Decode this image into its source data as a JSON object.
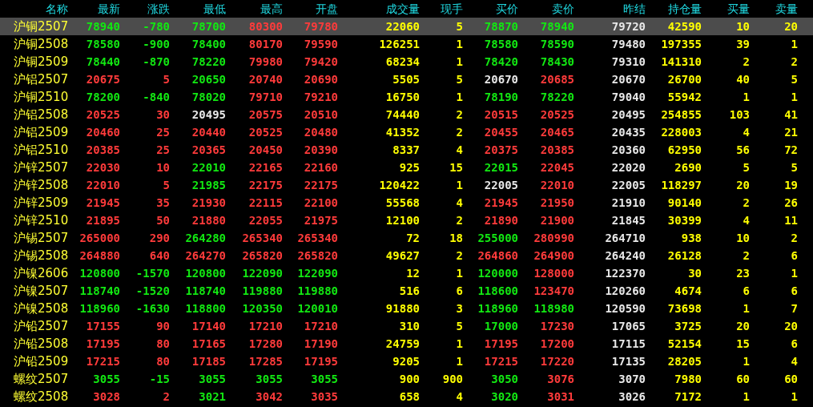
{
  "columns": [
    {
      "label": "名称",
      "kind": "name"
    },
    {
      "label": "最新",
      "kind": "price"
    },
    {
      "label": "涨跌",
      "kind": "price"
    },
    {
      "label": "最低",
      "kind": "price"
    },
    {
      "label": "最高",
      "kind": "price"
    },
    {
      "label": "开盘",
      "kind": "price"
    },
    {
      "label": "成交量",
      "kind": "qty"
    },
    {
      "label": "现手",
      "kind": "qty"
    },
    {
      "label": "买价",
      "kind": "price"
    },
    {
      "label": "卖价",
      "kind": "price"
    },
    {
      "label": "昨结",
      "kind": "settle"
    },
    {
      "label": "持仓量",
      "kind": "qty"
    },
    {
      "label": "买量",
      "kind": "qty"
    },
    {
      "label": "卖量",
      "kind": "qty"
    }
  ],
  "rows": [
    {
      "selected": true,
      "cells": [
        {
          "text": "沪铜2507"
        },
        {
          "text": "78940",
          "color": "#12e812"
        },
        {
          "text": "-780",
          "color": "#12e812"
        },
        {
          "text": "78700",
          "color": "#12e812"
        },
        {
          "text": "80300",
          "color": "#ff3b3b"
        },
        {
          "text": "79780",
          "color": "#ff3b3b"
        },
        {
          "text": "22060"
        },
        {
          "text": "5"
        },
        {
          "text": "78870",
          "color": "#12e812"
        },
        {
          "text": "78940",
          "color": "#12e812"
        },
        {
          "text": "79720"
        },
        {
          "text": "42590"
        },
        {
          "text": "10"
        },
        {
          "text": "20"
        }
      ]
    },
    {
      "selected": false,
      "cells": [
        {
          "text": "沪铜2508"
        },
        {
          "text": "78580",
          "color": "#12e812"
        },
        {
          "text": "-900",
          "color": "#12e812"
        },
        {
          "text": "78400",
          "color": "#12e812"
        },
        {
          "text": "80170",
          "color": "#ff3b3b"
        },
        {
          "text": "79590",
          "color": "#ff3b3b"
        },
        {
          "text": "126251"
        },
        {
          "text": "1"
        },
        {
          "text": "78580",
          "color": "#12e812"
        },
        {
          "text": "78590",
          "color": "#12e812"
        },
        {
          "text": "79480"
        },
        {
          "text": "197355"
        },
        {
          "text": "39"
        },
        {
          "text": "1"
        }
      ]
    },
    {
      "selected": false,
      "cells": [
        {
          "text": "沪铜2509"
        },
        {
          "text": "78440",
          "color": "#12e812"
        },
        {
          "text": "-870",
          "color": "#12e812"
        },
        {
          "text": "78220",
          "color": "#12e812"
        },
        {
          "text": "79980",
          "color": "#ff3b3b"
        },
        {
          "text": "79420",
          "color": "#ff3b3b"
        },
        {
          "text": "68234"
        },
        {
          "text": "1"
        },
        {
          "text": "78420",
          "color": "#12e812"
        },
        {
          "text": "78430",
          "color": "#12e812"
        },
        {
          "text": "79310"
        },
        {
          "text": "141310"
        },
        {
          "text": "2"
        },
        {
          "text": "2"
        }
      ]
    },
    {
      "selected": false,
      "cells": [
        {
          "text": "沪铝2507"
        },
        {
          "text": "20675",
          "color": "#ff3b3b"
        },
        {
          "text": "5",
          "color": "#ff3b3b"
        },
        {
          "text": "20650",
          "color": "#12e812"
        },
        {
          "text": "20740",
          "color": "#ff3b3b"
        },
        {
          "text": "20690",
          "color": "#ff3b3b"
        },
        {
          "text": "5505"
        },
        {
          "text": "5"
        },
        {
          "text": "20670",
          "color": "#e8e8e8"
        },
        {
          "text": "20685",
          "color": "#ff3b3b"
        },
        {
          "text": "20670"
        },
        {
          "text": "26700"
        },
        {
          "text": "40"
        },
        {
          "text": "5"
        }
      ]
    },
    {
      "selected": false,
      "cells": [
        {
          "text": "沪铜2510"
        },
        {
          "text": "78200",
          "color": "#12e812"
        },
        {
          "text": "-840",
          "color": "#12e812"
        },
        {
          "text": "78020",
          "color": "#12e812"
        },
        {
          "text": "79710",
          "color": "#ff3b3b"
        },
        {
          "text": "79210",
          "color": "#ff3b3b"
        },
        {
          "text": "16750"
        },
        {
          "text": "1"
        },
        {
          "text": "78190",
          "color": "#12e812"
        },
        {
          "text": "78220",
          "color": "#12e812"
        },
        {
          "text": "79040"
        },
        {
          "text": "55942"
        },
        {
          "text": "1"
        },
        {
          "text": "1"
        }
      ]
    },
    {
      "selected": false,
      "cells": [
        {
          "text": "沪铝2508"
        },
        {
          "text": "20525",
          "color": "#ff3b3b"
        },
        {
          "text": "30",
          "color": "#ff3b3b"
        },
        {
          "text": "20495",
          "color": "#e8e8e8"
        },
        {
          "text": "20575",
          "color": "#ff3b3b"
        },
        {
          "text": "20510",
          "color": "#ff3b3b"
        },
        {
          "text": "74440"
        },
        {
          "text": "2"
        },
        {
          "text": "20515",
          "color": "#ff3b3b"
        },
        {
          "text": "20525",
          "color": "#ff3b3b"
        },
        {
          "text": "20495"
        },
        {
          "text": "254855"
        },
        {
          "text": "103"
        },
        {
          "text": "41"
        }
      ]
    },
    {
      "selected": false,
      "cells": [
        {
          "text": "沪铝2509"
        },
        {
          "text": "20460",
          "color": "#ff3b3b"
        },
        {
          "text": "25",
          "color": "#ff3b3b"
        },
        {
          "text": "20440",
          "color": "#ff3b3b"
        },
        {
          "text": "20525",
          "color": "#ff3b3b"
        },
        {
          "text": "20480",
          "color": "#ff3b3b"
        },
        {
          "text": "41352"
        },
        {
          "text": "2"
        },
        {
          "text": "20455",
          "color": "#ff3b3b"
        },
        {
          "text": "20465",
          "color": "#ff3b3b"
        },
        {
          "text": "20435"
        },
        {
          "text": "228003"
        },
        {
          "text": "4"
        },
        {
          "text": "21"
        }
      ]
    },
    {
      "selected": false,
      "cells": [
        {
          "text": "沪铝2510"
        },
        {
          "text": "20385",
          "color": "#ff3b3b"
        },
        {
          "text": "25",
          "color": "#ff3b3b"
        },
        {
          "text": "20365",
          "color": "#ff3b3b"
        },
        {
          "text": "20450",
          "color": "#ff3b3b"
        },
        {
          "text": "20390",
          "color": "#ff3b3b"
        },
        {
          "text": "8337"
        },
        {
          "text": "4"
        },
        {
          "text": "20375",
          "color": "#ff3b3b"
        },
        {
          "text": "20385",
          "color": "#ff3b3b"
        },
        {
          "text": "20360"
        },
        {
          "text": "62950"
        },
        {
          "text": "56"
        },
        {
          "text": "72"
        }
      ]
    },
    {
      "selected": false,
      "cells": [
        {
          "text": "沪锌2507"
        },
        {
          "text": "22030",
          "color": "#ff3b3b"
        },
        {
          "text": "10",
          "color": "#ff3b3b"
        },
        {
          "text": "22010",
          "color": "#12e812"
        },
        {
          "text": "22165",
          "color": "#ff3b3b"
        },
        {
          "text": "22160",
          "color": "#ff3b3b"
        },
        {
          "text": "925"
        },
        {
          "text": "15"
        },
        {
          "text": "22015",
          "color": "#12e812"
        },
        {
          "text": "22045",
          "color": "#ff3b3b"
        },
        {
          "text": "22020"
        },
        {
          "text": "2690"
        },
        {
          "text": "5"
        },
        {
          "text": "5"
        }
      ]
    },
    {
      "selected": false,
      "cells": [
        {
          "text": "沪锌2508"
        },
        {
          "text": "22010",
          "color": "#ff3b3b"
        },
        {
          "text": "5",
          "color": "#ff3b3b"
        },
        {
          "text": "21985",
          "color": "#12e812"
        },
        {
          "text": "22175",
          "color": "#ff3b3b"
        },
        {
          "text": "22175",
          "color": "#ff3b3b"
        },
        {
          "text": "120422"
        },
        {
          "text": "1"
        },
        {
          "text": "22005",
          "color": "#e8e8e8"
        },
        {
          "text": "22010",
          "color": "#ff3b3b"
        },
        {
          "text": "22005"
        },
        {
          "text": "118297"
        },
        {
          "text": "20"
        },
        {
          "text": "19"
        }
      ]
    },
    {
      "selected": false,
      "cells": [
        {
          "text": "沪锌2509"
        },
        {
          "text": "21945",
          "color": "#ff3b3b"
        },
        {
          "text": "35",
          "color": "#ff3b3b"
        },
        {
          "text": "21930",
          "color": "#ff3b3b"
        },
        {
          "text": "22115",
          "color": "#ff3b3b"
        },
        {
          "text": "22100",
          "color": "#ff3b3b"
        },
        {
          "text": "55568"
        },
        {
          "text": "4"
        },
        {
          "text": "21945",
          "color": "#ff3b3b"
        },
        {
          "text": "21950",
          "color": "#ff3b3b"
        },
        {
          "text": "21910"
        },
        {
          "text": "90140"
        },
        {
          "text": "2"
        },
        {
          "text": "26"
        }
      ]
    },
    {
      "selected": false,
      "cells": [
        {
          "text": "沪锌2510"
        },
        {
          "text": "21895",
          "color": "#ff3b3b"
        },
        {
          "text": "50",
          "color": "#ff3b3b"
        },
        {
          "text": "21880",
          "color": "#ff3b3b"
        },
        {
          "text": "22055",
          "color": "#ff3b3b"
        },
        {
          "text": "21975",
          "color": "#ff3b3b"
        },
        {
          "text": "12100"
        },
        {
          "text": "2"
        },
        {
          "text": "21890",
          "color": "#ff3b3b"
        },
        {
          "text": "21900",
          "color": "#ff3b3b"
        },
        {
          "text": "21845"
        },
        {
          "text": "30399"
        },
        {
          "text": "4"
        },
        {
          "text": "11"
        }
      ]
    },
    {
      "selected": false,
      "cells": [
        {
          "text": "沪锡2507"
        },
        {
          "text": "265000",
          "color": "#ff3b3b"
        },
        {
          "text": "290",
          "color": "#ff3b3b"
        },
        {
          "text": "264280",
          "color": "#12e812"
        },
        {
          "text": "265340",
          "color": "#ff3b3b"
        },
        {
          "text": "265340",
          "color": "#ff3b3b"
        },
        {
          "text": "72"
        },
        {
          "text": "18"
        },
        {
          "text": "255000",
          "color": "#12e812"
        },
        {
          "text": "280990",
          "color": "#ff3b3b"
        },
        {
          "text": "264710"
        },
        {
          "text": "938"
        },
        {
          "text": "10"
        },
        {
          "text": "2"
        }
      ]
    },
    {
      "selected": false,
      "cells": [
        {
          "text": "沪锡2508"
        },
        {
          "text": "264880",
          "color": "#ff3b3b"
        },
        {
          "text": "640",
          "color": "#ff3b3b"
        },
        {
          "text": "264270",
          "color": "#ff3b3b"
        },
        {
          "text": "265820",
          "color": "#ff3b3b"
        },
        {
          "text": "265820",
          "color": "#ff3b3b"
        },
        {
          "text": "49627"
        },
        {
          "text": "2"
        },
        {
          "text": "264860",
          "color": "#ff3b3b"
        },
        {
          "text": "264900",
          "color": "#ff3b3b"
        },
        {
          "text": "264240"
        },
        {
          "text": "26128"
        },
        {
          "text": "2"
        },
        {
          "text": "6"
        }
      ]
    },
    {
      "selected": false,
      "cells": [
        {
          "text": "沪镍2606"
        },
        {
          "text": "120800",
          "color": "#12e812"
        },
        {
          "text": "-1570",
          "color": "#12e812"
        },
        {
          "text": "120800",
          "color": "#12e812"
        },
        {
          "text": "122090",
          "color": "#12e812"
        },
        {
          "text": "122090",
          "color": "#12e812"
        },
        {
          "text": "12"
        },
        {
          "text": "1"
        },
        {
          "text": "120000",
          "color": "#12e812"
        },
        {
          "text": "128000",
          "color": "#ff3b3b"
        },
        {
          "text": "122370"
        },
        {
          "text": "30"
        },
        {
          "text": "23"
        },
        {
          "text": "1"
        }
      ]
    },
    {
      "selected": false,
      "cells": [
        {
          "text": "沪镍2507"
        },
        {
          "text": "118740",
          "color": "#12e812"
        },
        {
          "text": "-1520",
          "color": "#12e812"
        },
        {
          "text": "118740",
          "color": "#12e812"
        },
        {
          "text": "119880",
          "color": "#12e812"
        },
        {
          "text": "119880",
          "color": "#12e812"
        },
        {
          "text": "516"
        },
        {
          "text": "6"
        },
        {
          "text": "118600",
          "color": "#12e812"
        },
        {
          "text": "123470",
          "color": "#ff3b3b"
        },
        {
          "text": "120260"
        },
        {
          "text": "4674"
        },
        {
          "text": "6"
        },
        {
          "text": "6"
        }
      ]
    },
    {
      "selected": false,
      "cells": [
        {
          "text": "沪镍2508"
        },
        {
          "text": "118960",
          "color": "#12e812"
        },
        {
          "text": "-1630",
          "color": "#12e812"
        },
        {
          "text": "118800",
          "color": "#12e812"
        },
        {
          "text": "120350",
          "color": "#12e812"
        },
        {
          "text": "120010",
          "color": "#12e812"
        },
        {
          "text": "91880"
        },
        {
          "text": "3"
        },
        {
          "text": "118960",
          "color": "#12e812"
        },
        {
          "text": "118980",
          "color": "#12e812"
        },
        {
          "text": "120590"
        },
        {
          "text": "73698"
        },
        {
          "text": "1"
        },
        {
          "text": "7"
        }
      ]
    },
    {
      "selected": false,
      "cells": [
        {
          "text": "沪铅2507"
        },
        {
          "text": "17155",
          "color": "#ff3b3b"
        },
        {
          "text": "90",
          "color": "#ff3b3b"
        },
        {
          "text": "17140",
          "color": "#ff3b3b"
        },
        {
          "text": "17210",
          "color": "#ff3b3b"
        },
        {
          "text": "17210",
          "color": "#ff3b3b"
        },
        {
          "text": "310"
        },
        {
          "text": "5"
        },
        {
          "text": "17000",
          "color": "#12e812"
        },
        {
          "text": "17230",
          "color": "#ff3b3b"
        },
        {
          "text": "17065"
        },
        {
          "text": "3725"
        },
        {
          "text": "20"
        },
        {
          "text": "20"
        }
      ]
    },
    {
      "selected": false,
      "cells": [
        {
          "text": "沪铅2508"
        },
        {
          "text": "17195",
          "color": "#ff3b3b"
        },
        {
          "text": "80",
          "color": "#ff3b3b"
        },
        {
          "text": "17165",
          "color": "#ff3b3b"
        },
        {
          "text": "17280",
          "color": "#ff3b3b"
        },
        {
          "text": "17190",
          "color": "#ff3b3b"
        },
        {
          "text": "24759"
        },
        {
          "text": "1"
        },
        {
          "text": "17195",
          "color": "#ff3b3b"
        },
        {
          "text": "17200",
          "color": "#ff3b3b"
        },
        {
          "text": "17115"
        },
        {
          "text": "52154"
        },
        {
          "text": "15"
        },
        {
          "text": "6"
        }
      ]
    },
    {
      "selected": false,
      "cells": [
        {
          "text": "沪铅2509"
        },
        {
          "text": "17215",
          "color": "#ff3b3b"
        },
        {
          "text": "80",
          "color": "#ff3b3b"
        },
        {
          "text": "17185",
          "color": "#ff3b3b"
        },
        {
          "text": "17285",
          "color": "#ff3b3b"
        },
        {
          "text": "17195",
          "color": "#ff3b3b"
        },
        {
          "text": "9205"
        },
        {
          "text": "1"
        },
        {
          "text": "17215",
          "color": "#ff3b3b"
        },
        {
          "text": "17220",
          "color": "#ff3b3b"
        },
        {
          "text": "17135"
        },
        {
          "text": "28205"
        },
        {
          "text": "1"
        },
        {
          "text": "4"
        }
      ]
    },
    {
      "selected": false,
      "cells": [
        {
          "text": "螺纹2507"
        },
        {
          "text": "3055",
          "color": "#12e812"
        },
        {
          "text": "-15",
          "color": "#12e812"
        },
        {
          "text": "3055",
          "color": "#12e812"
        },
        {
          "text": "3055",
          "color": "#12e812"
        },
        {
          "text": "3055",
          "color": "#12e812"
        },
        {
          "text": "900"
        },
        {
          "text": "900"
        },
        {
          "text": "3050",
          "color": "#12e812"
        },
        {
          "text": "3076",
          "color": "#ff3b3b"
        },
        {
          "text": "3070"
        },
        {
          "text": "7980"
        },
        {
          "text": "60"
        },
        {
          "text": "60"
        }
      ]
    },
    {
      "selected": false,
      "cells": [
        {
          "text": "螺纹2508"
        },
        {
          "text": "3028",
          "color": "#ff3b3b"
        },
        {
          "text": "2",
          "color": "#ff3b3b"
        },
        {
          "text": "3021",
          "color": "#12e812"
        },
        {
          "text": "3042",
          "color": "#ff3b3b"
        },
        {
          "text": "3035",
          "color": "#ff3b3b"
        },
        {
          "text": "658"
        },
        {
          "text": "4"
        },
        {
          "text": "3020",
          "color": "#12e812"
        },
        {
          "text": "3031",
          "color": "#ff3b3b"
        },
        {
          "text": "3026"
        },
        {
          "text": "7172"
        },
        {
          "text": "1"
        },
        {
          "text": "1"
        }
      ]
    }
  ]
}
